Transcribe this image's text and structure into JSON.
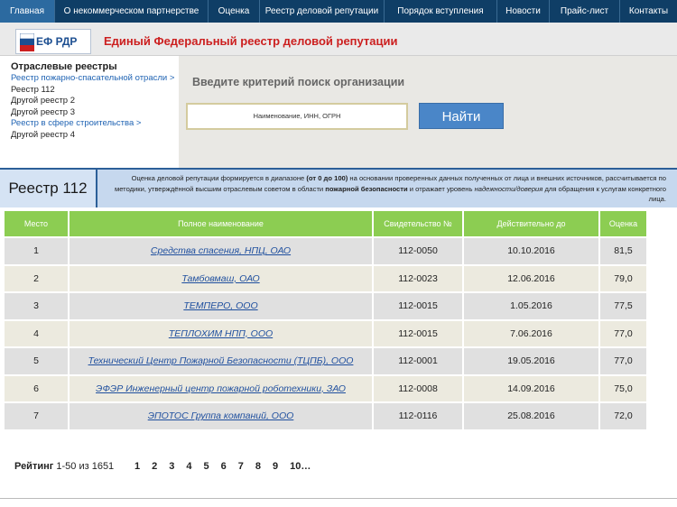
{
  "nav": {
    "items": [
      {
        "label": "Главная"
      },
      {
        "label": "О некоммерческом партнерстве"
      },
      {
        "label": "Оценка"
      },
      {
        "label": "Реестр деловой репутации"
      },
      {
        "label": "Порядок вступления"
      },
      {
        "label": "Новости"
      },
      {
        "label": "Прайс-лист"
      },
      {
        "label": "Контакты"
      }
    ],
    "active_index": 0
  },
  "header": {
    "logo_text": "ЕФ РДР",
    "site_title": "Единый Федеральный реестр деловой репутации"
  },
  "registries": {
    "heading": "Отраслевые реестры",
    "items": [
      {
        "label": "Реестр пожарно-спасательной отрасли >"
      },
      {
        "label": "Реестр 112"
      },
      {
        "label": "Другой реестр 2"
      },
      {
        "label": "Другой реестр 3"
      },
      {
        "label": "Реестр в сфере строительства >"
      },
      {
        "label": "Другой реестр 4"
      }
    ]
  },
  "search": {
    "heading": "Введите критерий поиск организации",
    "placeholder": "Наименование, ИНН, ОГРН",
    "button_label": "Найти"
  },
  "registry_bar": {
    "title": "Реестр 112",
    "desc_part1": "Оценка деловой репутации формируется в диапазоне ",
    "desc_bold1": "(от 0 до 100)",
    "desc_part2": " на основании проверенных данных полученных от лица и внешних источников, рассчитывается по методики, утверждённой высшим отраслевым советом в области ",
    "desc_bold2": "пожарной безопасности",
    "desc_part3": " и отражает уровень ",
    "desc_italic": "надежности/доверия",
    "desc_part4": " для обращения к услугам конкретного лица."
  },
  "table": {
    "headers": [
      "Место",
      "Полное наименование",
      "Свидетельство №",
      "Действительно до",
      "Оценка"
    ],
    "rows": [
      {
        "place": "1",
        "name": "Средства спасения, НПЦ, ОАО",
        "cert": "112-0050",
        "valid": "10.10.2016",
        "score": "81,5"
      },
      {
        "place": "2",
        "name": "Тамбовмаш, ОАО",
        "cert": "112-0023",
        "valid": "12.06.2016",
        "score": "79,0"
      },
      {
        "place": "3",
        "name": "ТЕМПЕРО, ООО",
        "cert": "112-0015",
        "valid": "1.05.2016",
        "score": "77,5"
      },
      {
        "place": "4",
        "name": "ТЕПЛОХИМ НПП, ООО",
        "cert": "112-0015",
        "valid": "7.06.2016",
        "score": "77,0"
      },
      {
        "place": "5",
        "name": "Технический Центр Пожарной Безопасности (ТЦПБ), ООО",
        "cert": "112-0001",
        "valid": "19.05.2016",
        "score": "77,0"
      },
      {
        "place": "6",
        "name": "ЭФЭР Инженерный центр пожарной роботехники, ЗАО",
        "cert": "112-0008",
        "valid": "14.09.2016",
        "score": "75,0"
      },
      {
        "place": "7",
        "name": "ЭПОТОС Группа компаний, ООО",
        "cert": "112-0116",
        "valid": "25.08.2016",
        "score": "72,0"
      }
    ]
  },
  "footer": {
    "rating_label": "Рейтинг",
    "range_text": "1-50 из 1651",
    "pages": [
      "1",
      "2",
      "3",
      "4",
      "5",
      "6",
      "7",
      "8",
      "9",
      "10…"
    ]
  },
  "colors": {
    "nav_bg": "#0f3e66",
    "header_green": "#8ccd52",
    "title_red": "#cc1f1f",
    "link_blue": "#1f63b3",
    "button_blue": "#4a86c8"
  }
}
